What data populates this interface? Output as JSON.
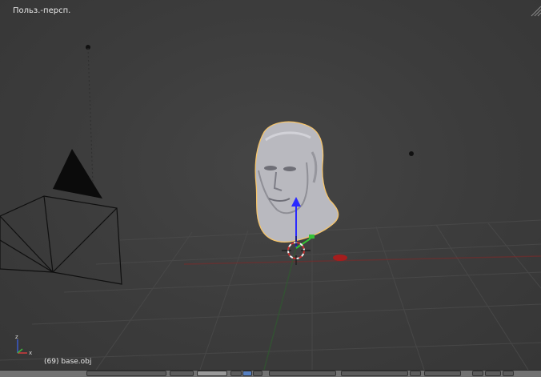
{
  "viewport": {
    "view_name": "Польз.-персп.",
    "object_info": "(69) base.obj"
  },
  "axes_widget": {
    "labels": [
      "x",
      "z"
    ]
  },
  "colors": {
    "background": "#3d3d3d",
    "grid": "#4a4a4a",
    "x_axis": "#8a2a2a",
    "y_axis": "#2f6a2f",
    "manipulator_z": "#2a2aff",
    "selection_outline": "#f5c46b",
    "mesh": "#bdbdc2"
  },
  "icons": {
    "camera": "camera-icon",
    "lamp": "lamp-icon",
    "cursor": "3d-cursor-icon",
    "manipulator": "transform-manipulator-icon"
  }
}
